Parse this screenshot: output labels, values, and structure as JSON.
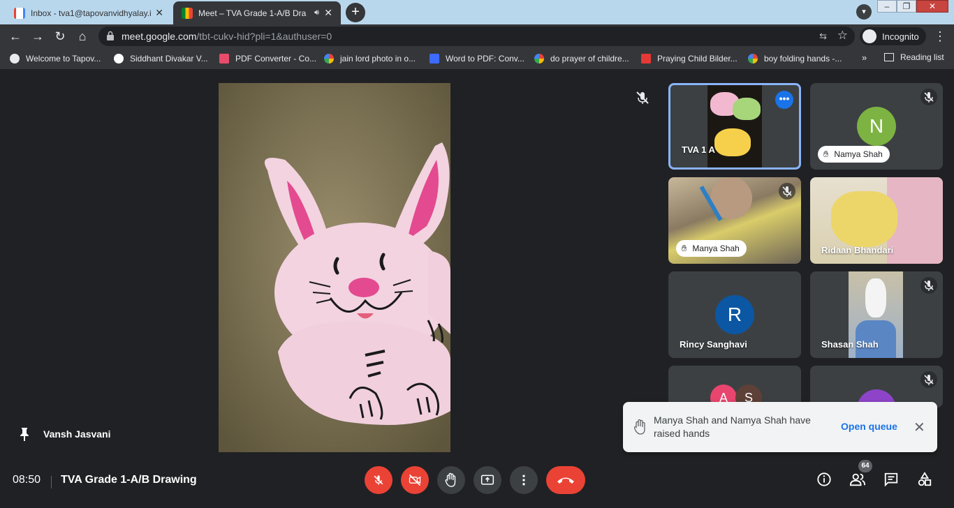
{
  "browser": {
    "tabs": [
      {
        "title": "Inbox - tva1@tapovanvidhyalay.i",
        "active": false
      },
      {
        "title": "Meet – TVA Grade 1-A/B Dra",
        "active": true
      }
    ],
    "new_tab": "+",
    "url_host": "meet.google.com",
    "url_path": "/tbt-cukv-hid?pli=1&authuser=0",
    "incognito_label": "Incognito",
    "bookmarks": [
      "Welcome to Tapov...",
      "Siddhant Divakar V...",
      "PDF Converter - Co...",
      "jain lord photo in o...",
      "Word to PDF: Conv...",
      "do prayer of childre...",
      "Praying Child Bilder...",
      "boy folding hands -..."
    ],
    "bookmarks_more": "»",
    "reading_list": "Reading list"
  },
  "meet": {
    "presenter_name": "Vansh Jasvani",
    "tiles": [
      {
        "name": "TVA 1 A"
      },
      {
        "name": "Namya Shah",
        "avatar_letter": "N"
      },
      {
        "name": "Manya Shah"
      },
      {
        "name": "Ridaan Bhandari"
      },
      {
        "name": "Rincy Sanghavi",
        "avatar_letter": "R"
      },
      {
        "name": "Shasan Shah"
      },
      {
        "avatar_letters": [
          "A",
          "S"
        ]
      },
      {}
    ],
    "toast": {
      "text": "Manya Shah and Namya Shah have raised hands",
      "action": "Open queue"
    },
    "clock": "08:50",
    "meeting_title": "TVA Grade 1-A/B Drawing",
    "people_count": "64"
  },
  "colors": {
    "accent_blue": "#1a73e8",
    "end_call_red": "#ea4335",
    "meet_bg": "#202124",
    "tile_bg": "#3c4043",
    "avatar_n": "#7cb342",
    "avatar_r": "#0b57a4"
  }
}
